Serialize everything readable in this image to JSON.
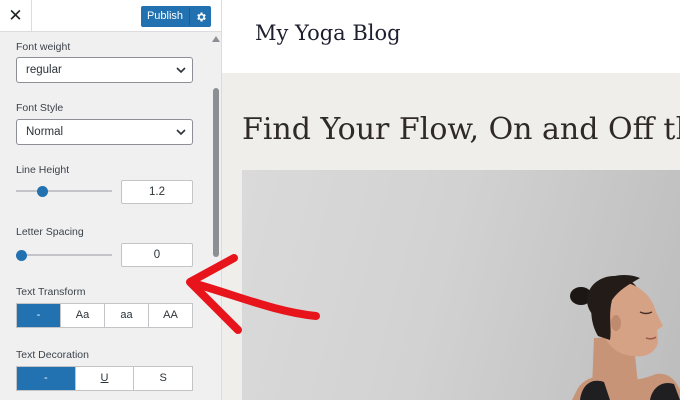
{
  "topbar": {
    "close_glyph": "✕",
    "publish_label": "Publish",
    "settings_icon": "gear-icon"
  },
  "controls": {
    "font_weight": {
      "label": "Font weight",
      "value": "regular"
    },
    "font_style": {
      "label": "Font Style",
      "value": "Normal"
    },
    "line_height": {
      "label": "Line Height",
      "value": "1.2",
      "slider_fraction": 0.28
    },
    "letter_spacing": {
      "label": "Letter Spacing",
      "value": "0",
      "slider_fraction": 0.0
    },
    "text_transform": {
      "label": "Text Transform",
      "options": [
        "-",
        "Aa",
        "aa",
        "AA"
      ],
      "selected": "-"
    },
    "text_decoration": {
      "label": "Text Decoration",
      "options": [
        "-",
        "U",
        "S"
      ],
      "selected": "-"
    }
  },
  "preview": {
    "site_title": "My Yoga Blog",
    "headline": "Find Your Flow, On and Off the"
  },
  "colors": {
    "accent": "#2271b1",
    "annotation_arrow": "#e8141b"
  }
}
